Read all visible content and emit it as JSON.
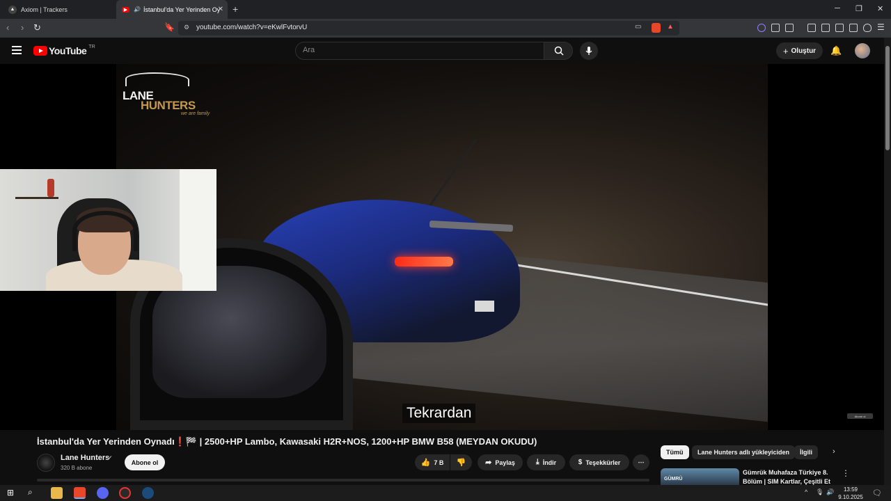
{
  "browser": {
    "tabs": [
      {
        "label": "Axiom | Trackers",
        "active": false
      },
      {
        "label": "İstanbul'da Yer Yerinden Oynadı",
        "active": true
      }
    ],
    "url": "youtube.com/watch?v=eKwlFvtorvU"
  },
  "youtube": {
    "logo_text": "YouTube",
    "region": "TR",
    "search_placeholder": "Ara",
    "create_label": "Oluştur"
  },
  "video": {
    "overlay_brand_line1": "LANE",
    "overlay_brand_line2": "HUNTERS",
    "overlay_brand_tag": "we are family",
    "subtitle": "Tekrardan",
    "subscribe_chip": "Abone ol",
    "title": "İstanbul'da Yer Yerinden Oynadı❗🏁 | 2500+HP Lambo, Kawasaki H2R+NOS, 1200+HP BMW B58 (MEYDAN OKUDU)"
  },
  "channel": {
    "name": "Lane Hunters",
    "verified_icon": "✔",
    "subscribers": "320 B abone",
    "subscribe_label": "Abone ol"
  },
  "actions": {
    "likes": "7 B",
    "share": "Paylaş",
    "download": "İndir",
    "thanks": "Teşekkürler",
    "more": "⋯"
  },
  "sidebar": {
    "chips": [
      "Tümü",
      "Lane Hunters adlı yükleyiciden",
      "İlgili"
    ],
    "recommendation": {
      "thumb_text": "GÜMRÜ",
      "title": "Gümrük Muhafaza Türkiye 8. Bölüm | SIM Kartlar, Çeşitli Et"
    }
  },
  "taskbar": {
    "time": "13:59",
    "date": "9.10.2025"
  },
  "colors": {
    "yt_red": "#ff0000",
    "brand_gold": "#c49a4a"
  }
}
